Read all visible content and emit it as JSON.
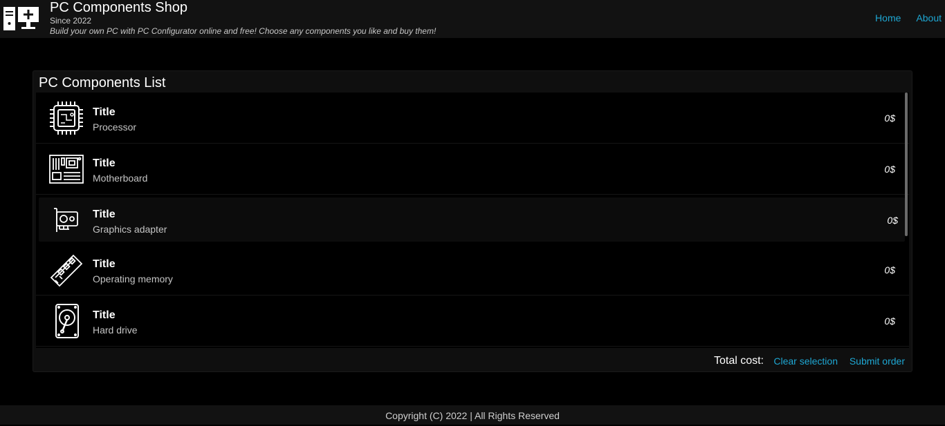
{
  "header": {
    "title": "PC Components Shop",
    "since": "Since 2022",
    "tagline": "Build your own PC with PC Configurator online and free! Choose any components you like and buy them!",
    "nav": [
      {
        "label": "Home"
      },
      {
        "label": "About"
      }
    ]
  },
  "panel": {
    "title": "PC Components List",
    "items": [
      {
        "icon": "processor-icon",
        "title": "Title",
        "subtitle": "Processor",
        "price": "0$"
      },
      {
        "icon": "motherboard-icon",
        "title": "Title",
        "subtitle": "Motherboard",
        "price": "0$"
      },
      {
        "icon": "graphics-card-icon",
        "title": "Title",
        "subtitle": "Graphics adapter",
        "price": "0$"
      },
      {
        "icon": "memory-icon",
        "title": "Title",
        "subtitle": "Operating memory",
        "price": "0$"
      },
      {
        "icon": "hard-drive-icon",
        "title": "Title",
        "subtitle": "Hard drive",
        "price": "0$"
      }
    ],
    "total_label": "Total cost:",
    "clear_label": "Clear selection",
    "submit_label": "Submit order"
  },
  "footer": {
    "copyright": "Copyright (C) 2022 | All Rights Reserved"
  },
  "colors": {
    "accent": "#1ea7d3",
    "background": "#000000",
    "header_bg": "#121212"
  }
}
